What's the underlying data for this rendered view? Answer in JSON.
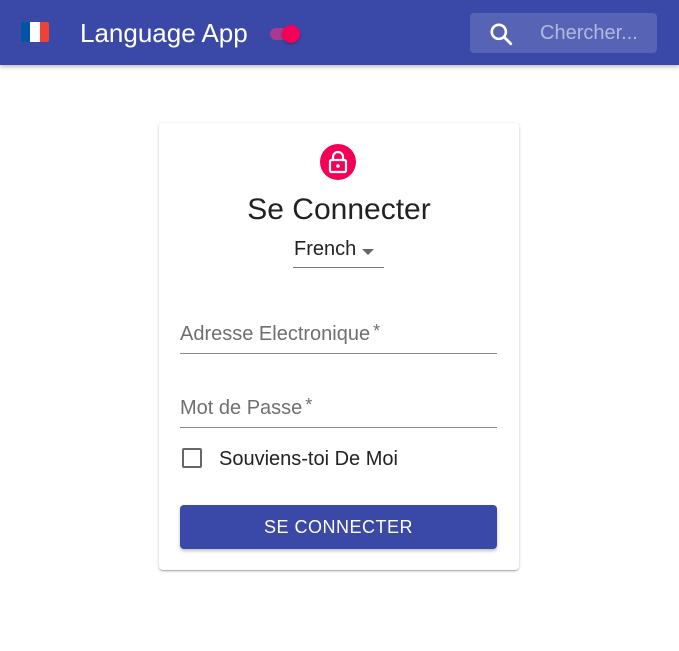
{
  "appbar": {
    "title": "Language App",
    "flag_icon": "french-flag-icon",
    "flag_colors": [
      "#0055a4",
      "#ffffff",
      "#ef4135"
    ],
    "theme_toggle_on": true,
    "search": {
      "placeholder": "Chercher...",
      "value": "",
      "icon": "search-icon"
    },
    "color": "#3a48a8"
  },
  "login": {
    "icon": "lock-icon",
    "icon_bg": "#f50057",
    "title": "Se Connecter",
    "language_select": {
      "selected": "French"
    },
    "email": {
      "label": "Adresse Electronique",
      "required_mark": "*",
      "value": ""
    },
    "password": {
      "label": "Mot de Passe",
      "required_mark": "*",
      "value": ""
    },
    "remember_me": {
      "label": "Souviens-toi De Moi",
      "checked": false
    },
    "submit_label": "SE CONNECTER"
  }
}
